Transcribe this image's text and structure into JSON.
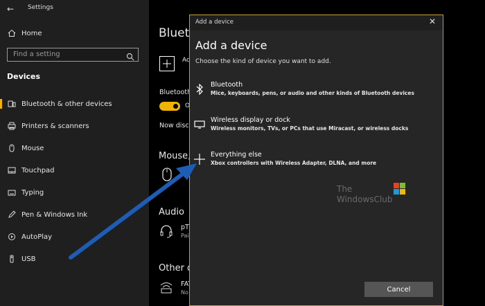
{
  "window": {
    "title": "Settings",
    "back_glyph": "←"
  },
  "sidebar": {
    "home": "Home",
    "search_placeholder": "Find a setting",
    "section": "Devices",
    "items": [
      {
        "label": "Bluetooth & other devices",
        "icon": "bluetooth-devices-icon"
      },
      {
        "label": "Printers & scanners",
        "icon": "printer-icon"
      },
      {
        "label": "Mouse",
        "icon": "mouse-icon"
      },
      {
        "label": "Touchpad",
        "icon": "touchpad-icon"
      },
      {
        "label": "Typing",
        "icon": "keyboard-icon"
      },
      {
        "label": "Pen & Windows Ink",
        "icon": "pen-icon"
      },
      {
        "label": "AutoPlay",
        "icon": "autoplay-icon"
      },
      {
        "label": "USB",
        "icon": "usb-icon"
      }
    ],
    "active_index": 0,
    "accent": "#f0b400"
  },
  "main": {
    "heading_fragment": "Blueto",
    "add_fragment": "Ac",
    "bluetooth_label_fragment": "Bluetooth",
    "toggle_state_fragment": "O",
    "discover_fragment": "Now disco",
    "mouse_heading_fragment": "Mouse,",
    "audio_heading": "Audio",
    "audio_device_fragment": "pT",
    "audio_status_fragment": "Pai",
    "other_heading_fragment": "Other d",
    "other_device_fragment": "FAT",
    "other_status_fragment": "No"
  },
  "dialog": {
    "titlebar": "Add a device",
    "close_glyph": "✕",
    "heading": "Add a device",
    "subtitle": "Choose the kind of device you want to add.",
    "options": [
      {
        "title": "Bluetooth",
        "description": "Mice, keyboards, pens, or audio and other kinds of Bluetooth devices",
        "icon": "bluetooth-icon"
      },
      {
        "title": "Wireless display or dock",
        "description": "Wireless monitors, TVs, or PCs that use Miracast, or wireless docks",
        "icon": "monitor-icon"
      },
      {
        "title": "Everything else",
        "description": "Xbox controllers with Wireless Adapter, DLNA, and more",
        "icon": "plus-icon"
      }
    ],
    "cancel": "Cancel",
    "border_color": "#c89f34"
  },
  "watermark": {
    "line1": "The",
    "line2": "WindowsClub"
  },
  "annotation": {
    "arrow_color": "#1e5db5"
  }
}
